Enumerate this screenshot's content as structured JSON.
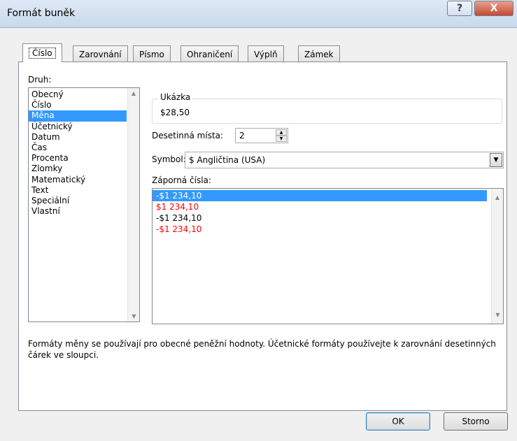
{
  "window": {
    "title": "Formát buněk",
    "help_label": "?",
    "close_label": "X"
  },
  "tabs": [
    {
      "label": "Číslo",
      "active": true
    },
    {
      "label": "Zarovnání",
      "active": false
    },
    {
      "label": "Písmo",
      "active": false
    },
    {
      "label": "Ohraničení",
      "active": false
    },
    {
      "label": "Výplň",
      "active": false
    },
    {
      "label": "Zámek",
      "active": false
    }
  ],
  "category": {
    "label": "Druh:",
    "items": [
      "Obecný",
      "Číslo",
      "Měna",
      "Účetnický",
      "Datum",
      "Čas",
      "Procenta",
      "Zlomky",
      "Matematický",
      "Text",
      "Speciální",
      "Vlastní"
    ],
    "selected": "Měna"
  },
  "sample": {
    "legend": "Ukázka",
    "value": "$28,50"
  },
  "decimals": {
    "label": "Desetinná místa:",
    "value": "2"
  },
  "symbol": {
    "label": "Symbol:",
    "value": "$ Angličtina (USA)"
  },
  "negative": {
    "label": "Záporná čísla:",
    "items": [
      {
        "text": "-$1 234,10",
        "color": "#000000",
        "selected": true
      },
      {
        "text": "$1 234,10",
        "color": "#ff0000",
        "selected": false
      },
      {
        "text": "-$1 234,10",
        "color": "#000000",
        "selected": false
      },
      {
        "text": "-$1 234,10",
        "color": "#ff0000",
        "selected": false
      }
    ]
  },
  "description": "Formáty měny se používají pro obecné peněžní hodnoty. Účetnické formáty používejte k zarovnání desetinných čárek ve sloupci.",
  "buttons": {
    "ok": "OK",
    "cancel": "Storno"
  },
  "colors": {
    "selection": "#3399ff",
    "negative_red": "#ff0000"
  }
}
